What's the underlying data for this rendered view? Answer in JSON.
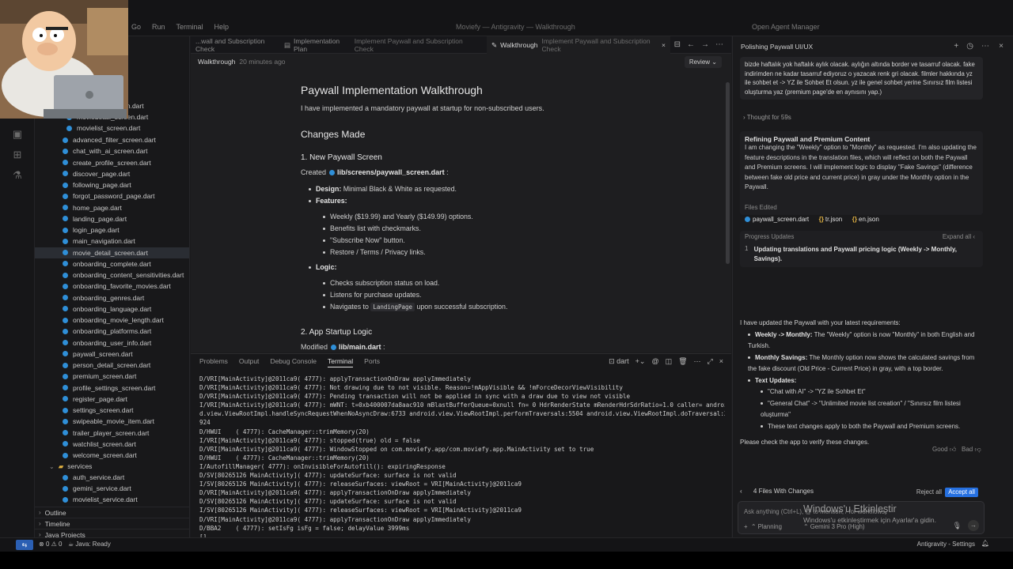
{
  "menu": [
    "Go",
    "Run",
    "Terminal",
    "Help"
  ],
  "window_title": "Moviefy — Antigravity — Walkthrough",
  "agent_manager": "Open Agent Manager",
  "explorer": {
    "files_top": [
      "...screen.dart",
      "moviedetail_screen.dart",
      "movielist_screen.dart"
    ],
    "files": [
      "advanced_filter_screen.dart",
      "chat_with_ai_screen.dart",
      "create_profile_screen.dart",
      "discover_page.dart",
      "following_page.dart",
      "forgot_password_page.dart",
      "home_page.dart",
      "landing_page.dart",
      "login_page.dart",
      "main_navigation.dart",
      "movie_detail_screen.dart",
      "onboarding_complete.dart",
      "onboarding_content_sensitivities.dart",
      "onboarding_favorite_movies.dart",
      "onboarding_genres.dart",
      "onboarding_language.dart",
      "onboarding_movie_length.dart",
      "onboarding_platforms.dart",
      "onboarding_user_info.dart",
      "paywall_screen.dart",
      "person_detail_screen.dart",
      "premium_screen.dart",
      "profile_settings_screen.dart",
      "register_page.dart",
      "settings_screen.dart",
      "swipeable_movie_item.dart",
      "trailer_player_screen.dart",
      "watchlist_screen.dart",
      "welcome_screen.dart"
    ],
    "selected_index": 10,
    "services_folder": "services",
    "service_files": [
      "auth_service.dart",
      "gemini_service.dart",
      "movielist_service.dart"
    ],
    "sections": [
      "Outline",
      "Timeline",
      "Java Projects"
    ]
  },
  "tabs": [
    {
      "title": "...wall and Subscription Check",
      "desc": ""
    },
    {
      "title": "Implementation Plan",
      "desc": "Implement Paywall and Subscription Check"
    },
    {
      "title": "Walkthrough",
      "desc": "Implement Paywall and Subscription Check"
    }
  ],
  "breadcrumb": {
    "title": "Walkthrough",
    "time": "20 minutes ago",
    "review": "Review"
  },
  "doc": {
    "title": "Paywall Implementation Walkthrough",
    "intro": "I have implemented a mandatory paywall at startup for non-subscribed users.",
    "changes": "Changes Made",
    "s1": "1. New Paywall Screen",
    "created_label": "Created",
    "created_file": "lib/screens/paywall_screen.dart",
    "design_label": "Design:",
    "design_text": "Minimal Black & White as requested.",
    "features_label": "Features:",
    "features": [
      "Weekly ($19.99) and Yearly ($149.99) options.",
      "Benefits list with checkmarks.",
      "\"Subscribe Now\" button.",
      "Restore / Terms / Privacy links."
    ],
    "logic_label": "Logic:",
    "logic": [
      "Checks subscription status on load.",
      "Listens for purchase updates."
    ],
    "logic_nav_pre": "Navigates to",
    "logic_nav_code": "LandingPage",
    "logic_nav_post": "upon successful subscription.",
    "s2": "2. App Startup Logic",
    "modified_label": "Modified",
    "modified_file": "lib/main.dart"
  },
  "panel": {
    "tabs": [
      "Problems",
      "Output",
      "Debug Console",
      "Terminal",
      "Ports"
    ],
    "active": "Terminal",
    "shell": "dart"
  },
  "terminal_lines": [
    "D/VRI[MainActivity]@2011ca9( 4777): applyTransactionOnDraw applyImmediately",
    "D/VRI[MainActivity]@2011ca9( 4777): Not drawing due to not visible. Reason=!mAppVisible && !mForceDecorViewVisibility",
    "D/VRI[MainActivity]@2011ca9( 4777): Pending transaction will not be applied in sync with a draw due to view not visible",
    "I/VRI[MainActivity]@2011ca9( 4777): mWNT: t=0xb400007da8aac910 mBlastBufferQueue=0xnull fn= 0 HdrRenderState mRenderHdrSdrRatio=1.0 caller= androi",
    "d.view.ViewRootImpl.handleSyncRequestWhenNoAsyncDraw:6733 android.view.ViewRootImpl.performTraversals:5504 android.view.ViewRootImpl.doTraversal:3",
    "924",
    "D/HWUI    ( 4777): CacheManager::trimMemory(20)",
    "I/VRI[MainActivity]@2011ca9( 4777): stopped(true) old = false",
    "D/VRI[MainActivity]@2011ca9( 4777): WindowStopped on com.moviefy.app/com.moviefy.app.MainActivity set to true",
    "D/HWUI    ( 4777): CacheManager::trimMemory(20)",
    "I/AutofillManager( 4777): onInvisibleForAutofill(): expiringResponse",
    "D/SV[80265126 MainActivity]( 4777): updateSurface: surface is not valid",
    "I/SV[80265126 MainActivity]( 4777): releaseSurfaces: viewRoot = VRI[MainActivity]@2011ca9",
    "D/VRI[MainActivity]@2011ca9( 4777): applyTransactionOnDraw applyImmediately",
    "D/SV[80265126 MainActivity]( 4777): updateSurface: surface is not valid",
    "I/SV[80265126 MainActivity]( 4777): releaseSurfaces: viewRoot = VRI[MainActivity]@2011ca9",
    "D/VRI[MainActivity]@2011ca9( 4777): applyTransactionOnDraw applyImmediately",
    "D/BBA2    ( 4777): setIsFg isFg = false; delayValue 3999ms",
    "[]"
  ],
  "status": {
    "errors": "0",
    "warnings": "0",
    "java": "Java: Ready",
    "right": "Antigravity - Settings"
  },
  "agent": {
    "title": "Polishing Paywall UI/UX",
    "user_message": "bizde haftalık yok haftalık aylık olacak. aylığın altında border ve tasarruf olacak. fake indirimden ne kadar tasarruf ediyoruz o yazacak renk gri olacak. filmler hakkında yz ile sohbet et -> YZ ile Sohbet Et olsun. yz ile genel sohbet yerine Sınırsız film listesi oluşturma yaz (premium page'de en aynısını yap.)",
    "thought": "Thought for 59s",
    "card_title": "Refining Paywall and Premium Content",
    "card_body": "I am changing the \"Weekly\" option to \"Monthly\" as requested. I'm also updating the feature descriptions in the translation files, which will reflect on both the Paywall and Premium screens. I will implement logic to display \"Fake Savings\" (difference between fake old price and current price) in gray under the Monthly option in the Paywall.",
    "files_edited_label": "Files Edited",
    "files_edited": [
      "paywall_screen.dart",
      "tr.json",
      "en.json"
    ],
    "progress_label": "Progress Updates",
    "expand_all": "Expand all",
    "progress_num": "1",
    "progress_text": "Updating translations and Paywall pricing logic (Weekly -> Monthly, Savings).",
    "final_intro": "I have updated the Paywall with your latest requirements:",
    "final_b1_label": "Weekly -> Monthly:",
    "final_b1_text": "The \"Weekly\" option is now \"Monthly\" in both English and Turkish.",
    "final_b2_label": "Monthly Savings:",
    "final_b2_text": "The Monthly option now shows the calculated savings from the fake discount (Old Price - Current Price) in gray, with a top border.",
    "final_b3_label": "Text Updates:",
    "final_sub": [
      "\"Chat with AI\" -> \"YZ ile Sohbet Et\"",
      "\"General Chat\" -> \"Unlimited movie list creation\" / \"Sınırsız film listesi oluşturma\"",
      "These text changes apply to both the Paywall and Premium screens."
    ],
    "final_outro": "Please check the app to verify these changes.",
    "good": "Good",
    "bad": "Bad",
    "changes_count": "4 Files With Changes",
    "reject_all": "Reject all",
    "accept_all": "Accept all",
    "input_placeholder": "Ask anything (Ctrl+L), @ to mention, / for workflows",
    "mode": "Planning",
    "model": "Gemini 3 Pro (High)"
  },
  "activation": {
    "title": "Windows'u Etkinleştir",
    "subtitle": "Windows'u etkinleştirmek için Ayarlar'a gidin."
  }
}
